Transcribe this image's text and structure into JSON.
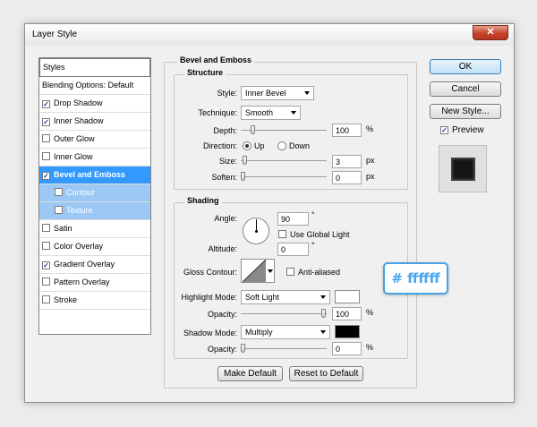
{
  "window": {
    "title": "Layer Style",
    "close_icon": "close-icon"
  },
  "styles_panel": {
    "header": "Styles",
    "items": [
      {
        "label": "Blending Options: Default",
        "checkbox": false,
        "checked": false,
        "state": "normal"
      },
      {
        "label": "Drop Shadow",
        "checkbox": true,
        "checked": true,
        "state": "normal"
      },
      {
        "label": "Inner Shadow",
        "checkbox": true,
        "checked": true,
        "state": "normal"
      },
      {
        "label": "Outer Glow",
        "checkbox": true,
        "checked": false,
        "state": "normal"
      },
      {
        "label": "Inner Glow",
        "checkbox": true,
        "checked": false,
        "state": "normal"
      },
      {
        "label": "Bevel and Emboss",
        "checkbox": true,
        "checked": true,
        "state": "selected"
      },
      {
        "label": "Contour",
        "checkbox": true,
        "checked": false,
        "state": "sub"
      },
      {
        "label": "Texture",
        "checkbox": true,
        "checked": false,
        "state": "sub"
      },
      {
        "label": "Satin",
        "checkbox": true,
        "checked": false,
        "state": "normal"
      },
      {
        "label": "Color Overlay",
        "checkbox": true,
        "checked": false,
        "state": "normal"
      },
      {
        "label": "Gradient Overlay",
        "checkbox": true,
        "checked": true,
        "state": "normal"
      },
      {
        "label": "Pattern Overlay",
        "checkbox": true,
        "checked": false,
        "state": "normal"
      },
      {
        "label": "Stroke",
        "checkbox": true,
        "checked": false,
        "state": "normal"
      }
    ]
  },
  "bevel": {
    "title": "Bevel and Emboss",
    "structure": {
      "title": "Structure",
      "style_label": "Style:",
      "style_value": "Inner Bevel",
      "technique_label": "Technique:",
      "technique_value": "Smooth",
      "depth_label": "Depth:",
      "depth_value": "100",
      "depth_unit": "%",
      "direction_label": "Direction:",
      "dir_up": "Up",
      "dir_down": "Down",
      "direction_selected": "Up",
      "size_label": "Size:",
      "size_value": "3",
      "size_unit": "px",
      "soften_label": "Soften:",
      "soften_value": "0",
      "soften_unit": "px"
    },
    "shading": {
      "title": "Shading",
      "angle_label": "Angle:",
      "angle_value": "90",
      "angle_unit": "°",
      "use_global_light": "Use Global Light",
      "use_global_light_checked": false,
      "altitude_label": "Altitude:",
      "altitude_value": "0",
      "altitude_unit": "°",
      "gloss_contour_label": "Gloss Contour:",
      "anti_aliased": "Anti-aliased",
      "anti_aliased_checked": false,
      "highlight_mode_label": "Highlight Mode:",
      "highlight_mode_value": "Soft Light",
      "highlight_color": "#ffffff",
      "opacity1_label": "Opacity:",
      "opacity1_value": "100",
      "opacity1_unit": "%",
      "shadow_mode_label": "Shadow Mode:",
      "shadow_mode_value": "Multiply",
      "shadow_color": "#000000",
      "opacity2_label": "Opacity:",
      "opacity2_value": "0",
      "opacity2_unit": "%"
    },
    "make_default": "Make Default",
    "reset_default": "Reset to Default"
  },
  "buttons": {
    "ok": "OK",
    "cancel": "Cancel",
    "new_style": "New Style...",
    "preview": "Preview",
    "preview_checked": true
  },
  "callout": "# ffffff",
  "sliders": {
    "depth": 0.12,
    "size": 0.02,
    "soften": 0.0,
    "opacity1": 1.0,
    "opacity2": 0.0
  }
}
